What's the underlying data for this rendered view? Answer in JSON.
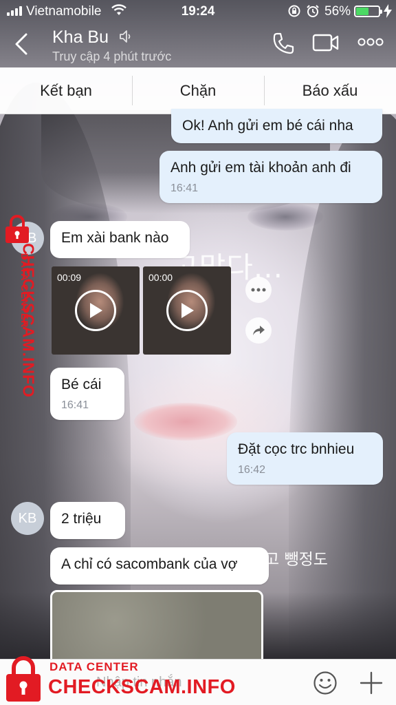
{
  "status_bar": {
    "carrier": "Vietnamobile",
    "time": "19:24",
    "battery_percent": "56%",
    "battery_level": 0.56
  },
  "header": {
    "contact_name": "Kha Bu",
    "presence": "Truy cập 4 phút trước"
  },
  "action_bar": {
    "add_friend": "Kết bạn",
    "block": "Chặn",
    "report": "Báo xấu"
  },
  "messages": [
    {
      "text": "Ok! Anh gửi em bé cái nha"
    },
    {
      "text": "Anh gửi em tài khoản anh đi",
      "time": "16:41"
    },
    {
      "text": "Em xài bank nào"
    },
    {
      "text": "Bé cái",
      "time": "16:41"
    },
    {
      "text": "Đặt cọc trc bnhieu",
      "time": "16:42"
    },
    {
      "text": "2 triệu"
    },
    {
      "text": "A chỉ có sacombank của vợ"
    }
  ],
  "avatar_initials": "KB",
  "videos": [
    {
      "duration": "00:09"
    },
    {
      "duration": "00:00"
    }
  ],
  "wallpaper_text": {
    "line1": "고맙다...",
    "line2": "고 뺑정도"
  },
  "input": {
    "placeholder": "Nhập tin nhắn"
  },
  "watermark": {
    "line1": "DATA CENTER",
    "line2": "CHECKSCAM.INFO"
  },
  "colors": {
    "outgoing_bubble": "#e4f0fc",
    "incoming_bubble": "#ffffff",
    "watermark_red": "#e21b23",
    "battery_green": "#4cd964"
  }
}
